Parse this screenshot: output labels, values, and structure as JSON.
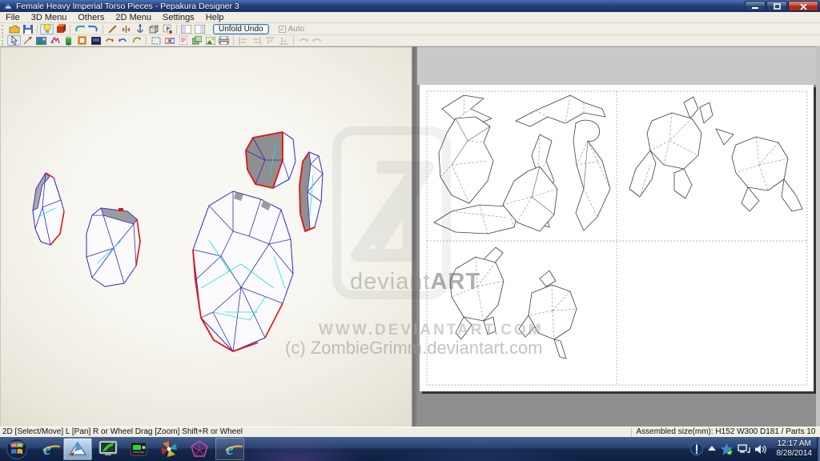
{
  "window": {
    "title": "Female Heavy Imperial Torso Pieces - Pepakura Designer 3"
  },
  "menu": {
    "items": [
      "File",
      "3D Menu",
      "Others",
      "2D Menu",
      "Settings",
      "Help"
    ]
  },
  "toolbars": {
    "unfold_undo_label": "Unfold Undo",
    "auto_label": "Auto",
    "auto_checked": "✓",
    "row1_icons": [
      "open-file",
      "save",
      "light-toggle",
      "texture-cube",
      "undo",
      "redo",
      "edit-pen",
      "flip-piece",
      "move-anchor",
      "solid-box",
      "select-flag",
      "window-layout-left",
      "window-layout-right"
    ],
    "row2_icons": [
      "select-move",
      "knife",
      "texture-image",
      "paint-colors",
      "cylinder",
      "box-orange",
      "dark-screen",
      "rotate-left",
      "rotate-right",
      "rotate-reset",
      "marquee",
      "join-parts",
      "part-note",
      "layers",
      "export-image",
      "print",
      "align-left",
      "align-right",
      "align-top",
      "align-bottom",
      "loop-back",
      "loop-forward"
    ]
  },
  "view3d": {
    "edge_colors": {
      "blue": "#2a2ac8",
      "cyan": "#22dede",
      "red": "#e81010"
    },
    "piece_count_visible": 5
  },
  "view2d": {
    "pages_visible": 4
  },
  "watermark": {
    "brand_light": "deviant",
    "brand_bold": "ART",
    "url": "WWW.DEVIANTART.COM",
    "credit": "(c) ZombieGrimm.deviantart.com"
  },
  "statusbar": {
    "left": "2D [Select/Move] L [Pan] R or Wheel Drag [Zoom] Shift+R or Wheel",
    "right": "Assembled size(mm): H152 W300 D181 / Parts 10"
  },
  "taskbar": {
    "apps": [
      "start",
      "internet-explorer",
      "pepakura-designer",
      "fern-app",
      "media-device",
      "photo-viewer",
      "model-viewer",
      "internet-explorer-2"
    ],
    "tray_icons": [
      "pen-tablet",
      "hidden-icons",
      "security",
      "network",
      "volume"
    ],
    "clock": {
      "time": "12:17 AM",
      "date": "8/28/2014"
    }
  }
}
